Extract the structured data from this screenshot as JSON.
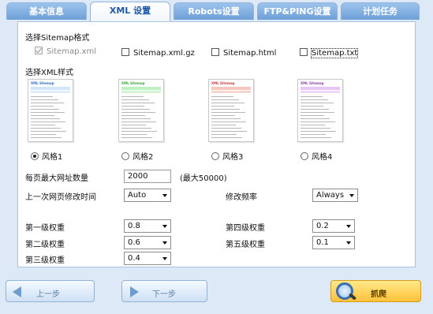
{
  "tabs": [
    {
      "label": "基本信息",
      "active": false
    },
    {
      "label": "XML 设置",
      "active": true
    },
    {
      "label": "Robots设置",
      "active": false
    },
    {
      "label": "FTP&PING设置",
      "active": false
    },
    {
      "label": "计划任务",
      "active": false
    }
  ],
  "sitemap_format": {
    "title": "选择Sitemap格式",
    "options": [
      {
        "label": "Sitemap.xml",
        "checked": true,
        "disabled": true
      },
      {
        "label": "Sitemap.xml.gz",
        "checked": false
      },
      {
        "label": "Sitemap.html",
        "checked": false
      },
      {
        "label": "Sitemap.txt",
        "checked": false
      }
    ]
  },
  "xml_style": {
    "title": "选择XML样式",
    "thumb_title": "XML Sitemap",
    "styles": [
      {
        "label": "风格1",
        "selected": true,
        "color": "#2f6fc7",
        "band": "#cfe6fb"
      },
      {
        "label": "风格2",
        "selected": false,
        "color": "#3aa63a",
        "band": "#bff0bf"
      },
      {
        "label": "风格3",
        "selected": false,
        "color": "#cc3a3a",
        "band": "#f7c6bd"
      },
      {
        "label": "风格4",
        "selected": false,
        "color": "#8b3fb3",
        "band": "#e7c6f5"
      }
    ]
  },
  "max_urls": {
    "label": "每页最大网址数量",
    "value": "2000",
    "hint": "(最大50000)"
  },
  "last_modified": {
    "label": "上一次网页修改时间",
    "value": "Auto"
  },
  "change_freq": {
    "label": "修改频率",
    "value": "Always"
  },
  "priorities": {
    "level1": {
      "label": "第一级权重",
      "value": "0.8"
    },
    "level2": {
      "label": "第二级权重",
      "value": "0.6"
    },
    "level3": {
      "label": "第三级权重",
      "value": "0.4"
    },
    "level4": {
      "label": "第四级权重",
      "value": "0.2"
    },
    "level5": {
      "label": "第五级权重",
      "value": "0.1"
    }
  },
  "buttons": {
    "prev": "上一步",
    "next": "下一步",
    "crawl": "抓爬"
  }
}
